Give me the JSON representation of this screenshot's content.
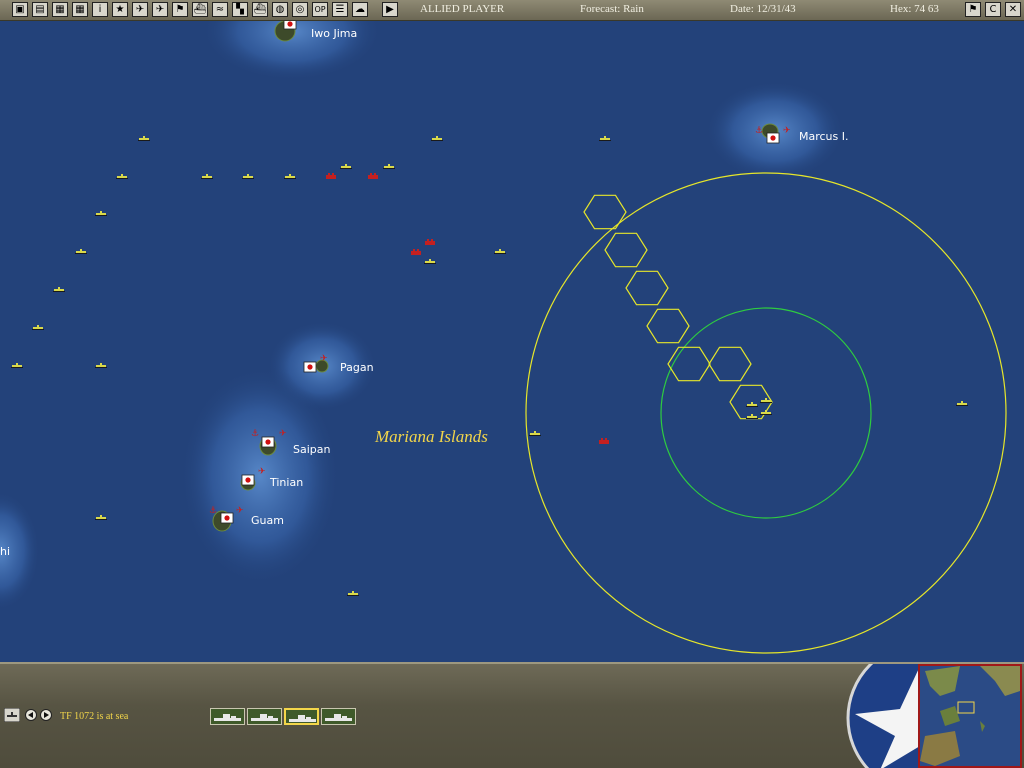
{
  "toolbar": {
    "buttons": [
      {
        "icon": "save-icon",
        "glyph": "▣"
      },
      {
        "icon": "document-icon",
        "glyph": "▤"
      },
      {
        "icon": "reports-icon",
        "glyph": "▦"
      },
      {
        "icon": "reports-alt-icon",
        "glyph": "▦"
      },
      {
        "icon": "info-icon",
        "glyph": "i"
      },
      {
        "icon": "star-icon",
        "glyph": "★"
      },
      {
        "icon": "air-unit-icon",
        "glyph": "✈"
      },
      {
        "icon": "air-unit-alt-icon",
        "glyph": "✈"
      },
      {
        "icon": "flag-icon",
        "glyph": "⚑"
      },
      {
        "icon": "ship-icon",
        "glyph": "⛴"
      },
      {
        "icon": "convoy-icon",
        "glyph": "≈"
      },
      {
        "icon": "color-grid-icon",
        "glyph": "▚"
      },
      {
        "icon": "fleet-icon",
        "glyph": "⛴"
      },
      {
        "icon": "globe-icon",
        "glyph": "◍"
      },
      {
        "icon": "cycle-icon",
        "glyph": "◎"
      },
      {
        "icon": "op-icon",
        "glyph": "OP"
      },
      {
        "icon": "list-icon",
        "glyph": "☰"
      },
      {
        "icon": "weather-icon",
        "glyph": "☁"
      },
      {
        "icon": "end-turn-icon",
        "glyph": "▶"
      }
    ],
    "side": "ALLIED PLAYER",
    "forecast": "Forecast: Rain",
    "date": "Date: 12/31/43",
    "hex": "Hex: 74  63",
    "right_buttons": [
      {
        "icon": "flag-toggle-icon",
        "glyph": "⚑"
      },
      {
        "icon": "c-button-icon",
        "glyph": "C"
      },
      {
        "icon": "exit-icon",
        "glyph": "✕"
      }
    ]
  },
  "map": {
    "region_label": "Mariana Islands",
    "islands": [
      {
        "name": "Iwo Jima"
      },
      {
        "name": "Marcus I."
      },
      {
        "name": "Pagan"
      },
      {
        "name": "Saipan"
      },
      {
        "name": "Tinian"
      },
      {
        "name": "Guam"
      },
      {
        "name": "hi"
      }
    ]
  },
  "bottom": {
    "tf_status": "TF 1072 is at sea",
    "ship_slots": 4,
    "selected_slot": 3
  },
  "colors": {
    "ocean": "#23427a",
    "range_outer": "#e6e62a",
    "range_inner": "#2ecc40",
    "hex_path": "#e6e62a",
    "allied_unit": "#d9d94a",
    "japanese_unit": "#c42020",
    "region_label": "#f3d64a"
  }
}
